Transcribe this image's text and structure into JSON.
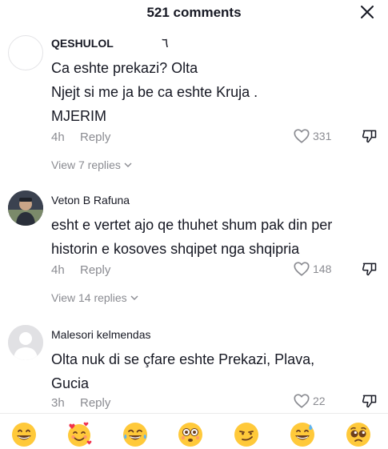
{
  "header": {
    "title": "521 comments"
  },
  "comments": [
    {
      "username": "QESHULOL",
      "username_extra": "٦",
      "lines": [
        "Ca eshte prekazi? Olta",
        "Njejt si me ja be ca eshte Kruja .",
        "MJERIM"
      ],
      "time": "4h",
      "reply_label": "Reply",
      "likes": "331",
      "view_replies": "View 7 replies"
    },
    {
      "username": "Veton B Rafuna",
      "lines": [
        "esht e vertet ajo qe thuhet shum pak din per",
        "historin e kosoves shqipet nga shqipria"
      ],
      "time": "4h",
      "reply_label": "Reply",
      "likes": "148",
      "view_replies": "View 14 replies"
    },
    {
      "username": "Malesori kelmendas",
      "lines": [
        "Olta nuk di se çfare eshte Prekazi, Plava,",
        "Gucia"
      ],
      "time": "3h",
      "reply_label": "Reply",
      "likes": "22"
    }
  ],
  "emoji_bar": [
    "grinning-face-emoji",
    "smiling-face-with-hearts-emoji",
    "tears-of-joy-emoji",
    "flushed-face-emoji",
    "smirking-face-emoji",
    "grinning-sweat-emoji",
    "pleading-face-emoji"
  ],
  "colors": {
    "text": "#161823",
    "secondary": "#8a8b91",
    "emoji_yellow": "#ffc93a"
  }
}
